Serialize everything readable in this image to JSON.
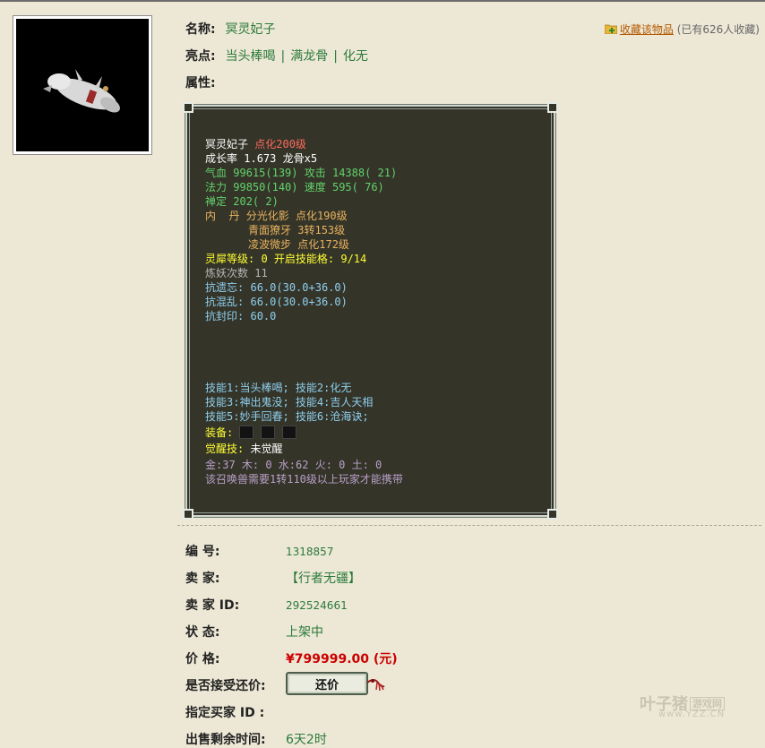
{
  "item": {
    "name_label": "名称:",
    "name": "冥灵妃子",
    "highlight_label": "亮点:",
    "highlights": [
      "当头棒喝",
      "满龙骨",
      "化无"
    ],
    "highlight_sep": "|",
    "attr_label": "属性:",
    "favorite_link": "收藏该物品",
    "favorite_count": "(已有626人收藏)"
  },
  "stats": {
    "name": "冥灵妃子",
    "enhance": "点化200级",
    "growth_label": "成长率",
    "growth": "1.673",
    "dragon_bone": "龙骨x5",
    "hp_label": "气血",
    "hp": "99615(139)",
    "atk_label": "攻击",
    "atk": "14388( 21)",
    "mp_label": "法力",
    "mp": "99850(140)",
    "spd_label": "速度",
    "spd": "595( 76)",
    "calm_label": "禅定",
    "calm": "202( 2)",
    "core_label": "内  丹",
    "core1_name": "分光化影",
    "core1_level": "点化190级",
    "core2_name": "青面獠牙",
    "core2_level": "3转153级",
    "core3_name": "凌波微步",
    "core3_level": "点化172级",
    "spirit_line": "灵犀等级: 0 开启技能格: 9/14",
    "refine_label": "炼妖次数",
    "refine": "11",
    "resist1_label": "抗遗忘:",
    "resist1": "66.0(30.0+36.0)",
    "resist2_label": "抗混乱:",
    "resist2": "66.0(30.0+36.0)",
    "resist3_label": "抗封印:",
    "resist3": "60.0",
    "skills1": "技能1:当头棒喝; 技能2:化无",
    "skills2": "技能3:神出鬼没; 技能4:吉人天相",
    "skills3": "技能5:妙手回春; 技能6:沧海诀;",
    "equip_label": "装备:",
    "awaken_label": "觉醒技:",
    "awaken": "未觉醒",
    "elements": "金:37 木: 0 水:62 火: 0 土: 0",
    "requirement": "该召唤兽需要1转110级以上玩家才能携带"
  },
  "details": {
    "id_label": "编        号:",
    "id": "1318857",
    "seller_label": "卖        家:",
    "seller": "【行者无疆】",
    "seller_id_label": "卖  家  ID:",
    "seller_id": "292524661",
    "status_label": "状        态:",
    "status": "上架中",
    "price_label": "价        格:",
    "price": "¥799999.00 (元)",
    "bargain_label": "是否接受还价:",
    "bargain_button": "还价",
    "buyer_label": "指定买家 ID  :",
    "time_label": "出售剩余时间:",
    "time_left": "6天2时"
  },
  "watermark": {
    "text": "叶子猪",
    "box": "游戏网",
    "url": "www.YZZ.CN"
  },
  "colors": {
    "page_bg": "#ede8d6",
    "panel_bg": "#343429",
    "value_green": "#2a7a3a",
    "price_red": "#cc0000",
    "link_orange": "#b25a00"
  }
}
